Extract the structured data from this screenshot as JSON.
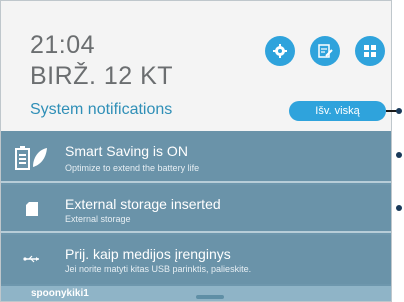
{
  "status": {
    "time": "21:04",
    "date": "BIRŽ. 12 KT",
    "section_label": "System notifications",
    "clear_button_label": "Išv. viską"
  },
  "quick_buttons": [
    {
      "icon": "settings-gear-icon"
    },
    {
      "icon": "edit-note-icon"
    },
    {
      "icon": "grid-apps-icon"
    }
  ],
  "notifications": [
    {
      "title": "Smart Saving is ON",
      "subtitle": "Optimize to extend the battery life",
      "icon": "battery-leaf-icon"
    },
    {
      "title": "External storage inserted",
      "subtitle": "External storage",
      "icon": "sd-card-icon"
    },
    {
      "title": "Prij. kaip medijos įrenginys",
      "subtitle": "Jei norite matyti kitas USB parinktis, palieskite.",
      "icon": "usb-icon"
    }
  ],
  "footer": {
    "label": "spoonykiki1"
  },
  "colors": {
    "accent": "#2fa3dc",
    "list_bg": "#6a93a9",
    "title_blue": "#2f8fb7"
  }
}
